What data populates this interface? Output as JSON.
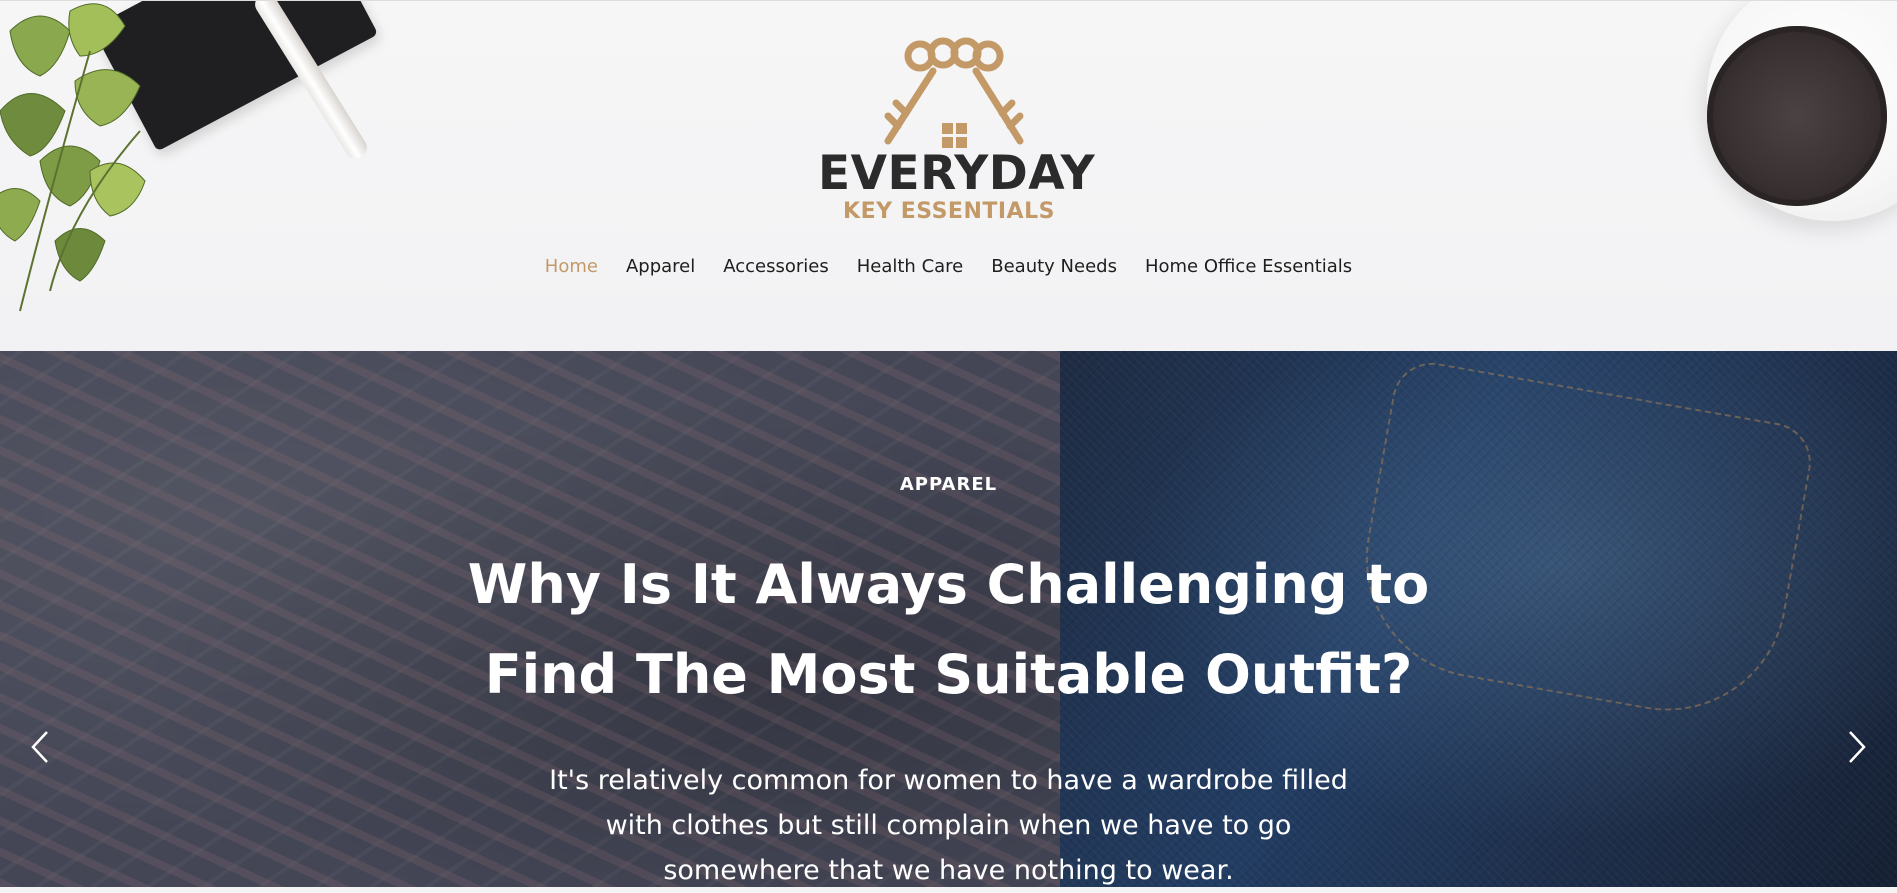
{
  "brand": {
    "name": "EVERYDAY",
    "tagline": "KEY ESSENTIALS",
    "colors": {
      "accent": "#c39a67",
      "dark": "#2b2b2b"
    }
  },
  "nav": {
    "items": [
      {
        "label": "Home",
        "active": true
      },
      {
        "label": "Apparel",
        "active": false
      },
      {
        "label": "Accessories",
        "active": false
      },
      {
        "label": "Health Care",
        "active": false
      },
      {
        "label": "Beauty Needs",
        "active": false
      },
      {
        "label": "Home Office Essentials",
        "active": false
      }
    ]
  },
  "hero": {
    "category": "APPAREL",
    "title_line1": "Why Is It Always Challenging to",
    "title_line2": "Find The Most Suitable Outfit?",
    "text_line1": "It's relatively common for women to have a wardrobe filled",
    "text_line2": "with clothes but still complain when we have to go",
    "text_line3": "somewhere that we have nothing to wear.",
    "prev_icon": "chevron-left-icon",
    "next_icon": "chevron-right-icon"
  }
}
